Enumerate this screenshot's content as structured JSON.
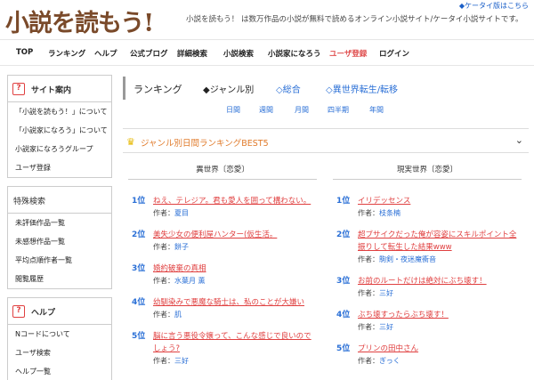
{
  "header": {
    "logo": "小説を読もう!",
    "tagline": "小説を読もう！ は数万作品の小説が無料で読めるオンライン小説サイト/ケータイ小説サイトです。",
    "mobile_link": "◆ケータイ版はこちら"
  },
  "gnav": [
    "TOP",
    "ランキング",
    "ヘルプ",
    "公式ブログ",
    "詳細検索",
    "小説検索",
    "小説家になろう",
    "ユーザ登録",
    "ログイン"
  ],
  "sidebar": {
    "site_guide": {
      "icon": "question-icon",
      "title": "サイト案内",
      "items": [
        "「小説を読もう！」について",
        "「小説家になろう」について",
        "小説家になろうグループ",
        "ユーザ登録"
      ]
    },
    "special_search": {
      "title": "特殊検索",
      "items": [
        "未評価作品一覧",
        "未感想作品一覧",
        "平均点順作者一覧",
        "閲覧履歴"
      ]
    },
    "help": {
      "icon": "question-icon",
      "title": "ヘルプ",
      "items": [
        "Nコードについて",
        "ユーザ検索",
        "ヘルプ一覧"
      ]
    }
  },
  "ranking": {
    "title": "ランキング",
    "tabs": [
      "◆ジャンル別",
      "◇総合",
      "◇異世界転生/転移"
    ],
    "periods": [
      "日間",
      "週間",
      "月間",
      "四半期",
      "年間"
    ],
    "best5_title": "ジャンル別日間ランキングBEST5",
    "author_label": "作者：",
    "columns": [
      {
        "heading": "異世界〔恋愛〕",
        "entries": [
          {
            "rank": "1位",
            "title": "ねえ、テレジア。君も愛人を囲って構わない。",
            "author": "夏目"
          },
          {
            "rank": "2位",
            "title": "美失少女の便利屋ハンター(仮生活。",
            "author": "餅子"
          },
          {
            "rank": "3位",
            "title": "婚約破棄の真相",
            "author": "水葉月 薫"
          },
          {
            "rank": "4位",
            "title": "幼馴染みで悪魔な騎士は、私のことが大嫌い",
            "author": "肌"
          },
          {
            "rank": "5位",
            "title": "脳に言う悪役令嬢って、こんな感じで良いのでしょう?",
            "author": "三好"
          }
        ]
      },
      {
        "heading": "現実世界〔恋愛〕",
        "entries": [
          {
            "rank": "1位",
            "title": "イリデッセンス",
            "author": "枝条楠"
          },
          {
            "rank": "2位",
            "title": "超ブサイクだった俺が容姿にスキルポイント全振りして転生した結果www",
            "author": "駒剣・夜迷魔衝音"
          },
          {
            "rank": "3位",
            "title": "お前のルートだけは絶対にぶち壊す！",
            "author": "三好"
          },
          {
            "rank": "4位",
            "title": "ぶち壊すったらぶち壊す！",
            "author": "三好"
          },
          {
            "rank": "5位",
            "title": "プリンの田中さん",
            "author": "ぎっく"
          }
        ]
      }
    ]
  },
  "colors": {
    "accent": "#e04040",
    "link": "#2a6fd6",
    "logo": "#7a4a2a",
    "best5": "#e07a2a"
  }
}
